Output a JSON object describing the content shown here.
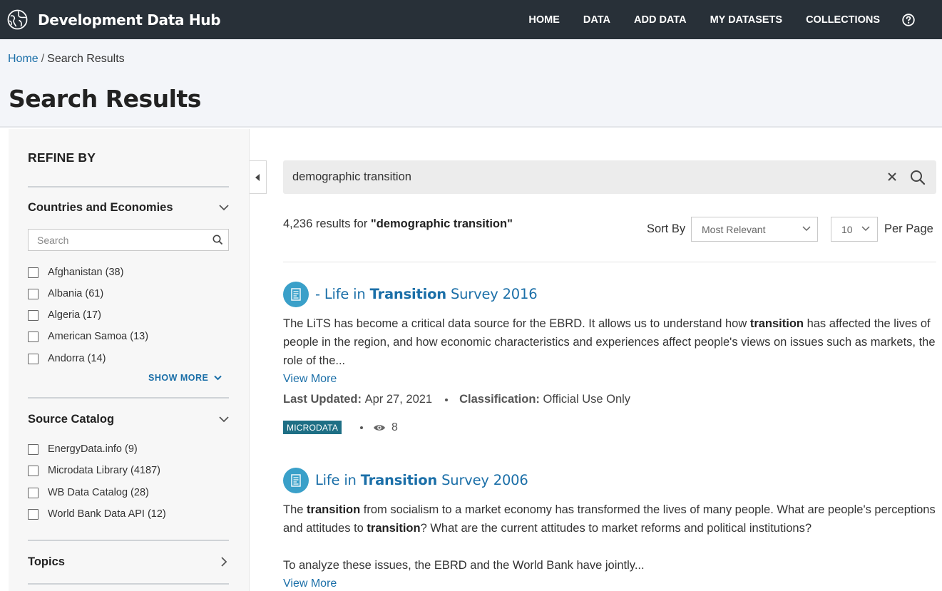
{
  "app": {
    "name": "Development Data Hub"
  },
  "nav": {
    "items": [
      "HOME",
      "DATA",
      "ADD DATA",
      "MY DATASETS",
      "COLLECTIONS"
    ],
    "help_icon": "question-circle-icon"
  },
  "breadcrumb": {
    "home": "Home",
    "separator": "/",
    "current": "Search Results"
  },
  "page_title": "Search Results",
  "sidebar": {
    "title": "REFINE BY",
    "countries": {
      "title": "Countries and Economies",
      "search_placeholder": "Search",
      "items": [
        {
          "label": "Afghanistan (38)"
        },
        {
          "label": "Albania (61)"
        },
        {
          "label": "Algeria (17)"
        },
        {
          "label": "American Samoa (13)"
        },
        {
          "label": "Andorra (14)"
        }
      ],
      "show_more": "SHOW MORE"
    },
    "source_catalog": {
      "title": "Source Catalog",
      "items": [
        {
          "label": "EnergyData.info (9)"
        },
        {
          "label": "Microdata Library (4187)"
        },
        {
          "label": "WB Data Catalog (28)"
        },
        {
          "label": "World Bank Data API (12)"
        }
      ]
    },
    "topics": {
      "title": "Topics"
    }
  },
  "search": {
    "query": "demographic transition"
  },
  "summary": {
    "count_text": "4,236 results for ",
    "query_quoted": "\"demographic transition\"",
    "sort_label": "Sort By",
    "sort_value": "Most Relevant",
    "per_page_value": "10",
    "per_page_label": "Per Page"
  },
  "results": [
    {
      "title_prefix": "- Life in ",
      "title_highlight": "Transition",
      "title_suffix": " Survey 2016",
      "desc_parts": [
        "The LiTS has become a critical data source for the EBRD. It allows us to understand how ",
        "transition",
        " has affected the lives of people in the region, and how economic characteristics and experiences affect people's views on issues such as markets, the role of the..."
      ],
      "view_more": "View More",
      "last_updated_label": "Last Updated:",
      "last_updated": "Apr 27, 2021",
      "classification_label": "Classification:",
      "classification": "Official Use Only",
      "badge": "MICRODATA",
      "views": "8"
    },
    {
      "title_prefix": "Life in ",
      "title_highlight": "Transition",
      "title_suffix": " Survey 2006",
      "desc_parts": [
        "The ",
        "transition",
        " from socialism to a market economy has transformed the lives of many people. What are people's perceptions and attitudes to ",
        "transition",
        "? What are the current attitudes to market reforms and political institutions?"
      ],
      "desc_para2": "To analyze these issues, the EBRD and the World Bank have jointly...",
      "view_more": "View More"
    }
  ],
  "colors": {
    "topbar": "#283038",
    "link": "#1b6fa8",
    "badge": "#1e6f85",
    "result_icon": "#3aa0c9"
  }
}
